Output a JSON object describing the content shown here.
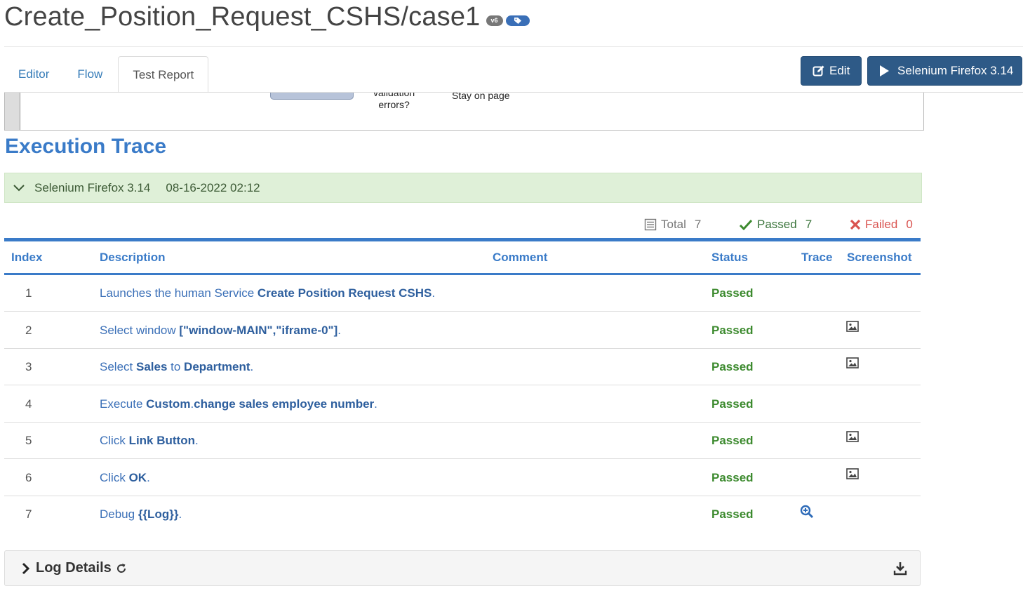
{
  "page": {
    "title": "Create_Position_Request_CSHS/case1",
    "version_badge": "v6"
  },
  "tabs": [
    {
      "label": "Editor"
    },
    {
      "label": "Flow"
    },
    {
      "label": "Test Report"
    }
  ],
  "toolbar": {
    "edit_label": "Edit",
    "run_label": "Selenium Firefox 3.14"
  },
  "diagram": {
    "question_line1": "validation",
    "question_line2": "errors?",
    "outcome": "Stay on page"
  },
  "section_title": "Execution Trace",
  "run": {
    "browser": "Selenium Firefox 3.14",
    "timestamp": "08-16-2022 02:12"
  },
  "summary": {
    "total_label": "Total",
    "total_value": "7",
    "passed_label": "Passed",
    "passed_value": "7",
    "failed_label": "Failed",
    "failed_value": "0"
  },
  "table": {
    "headers": {
      "index": "Index",
      "description": "Description",
      "comment": "Comment",
      "status": "Status",
      "trace": "Trace",
      "screenshot": "Screenshot"
    },
    "rows": [
      {
        "index": "1",
        "pre": "Launches the human Service ",
        "b1": "Create Position Request CSHS",
        "mid": "",
        "b2": "",
        "post": ".",
        "status": "Passed",
        "trace": false,
        "screenshot": false
      },
      {
        "index": "2",
        "pre": "Select window ",
        "b1": "[\"window-MAIN\",\"iframe-0\"]",
        "mid": "",
        "b2": "",
        "post": ".",
        "status": "Passed",
        "trace": false,
        "screenshot": true
      },
      {
        "index": "3",
        "pre": "Select ",
        "b1": "Sales",
        "mid": " to ",
        "b2": "Department",
        "post": ".",
        "status": "Passed",
        "trace": false,
        "screenshot": true
      },
      {
        "index": "4",
        "pre": "Execute ",
        "b1": "Custom",
        "mid": ".",
        "b2": "change sales employee number",
        "post": ".",
        "status": "Passed",
        "trace": false,
        "screenshot": false
      },
      {
        "index": "5",
        "pre": "Click ",
        "b1": "Link Button",
        "mid": "",
        "b2": "",
        "post": ".",
        "status": "Passed",
        "trace": false,
        "screenshot": true
      },
      {
        "index": "6",
        "pre": "Click ",
        "b1": "OK",
        "mid": "",
        "b2": "",
        "post": ".",
        "status": "Passed",
        "trace": false,
        "screenshot": true
      },
      {
        "index": "7",
        "pre": "Debug ",
        "b1": "{{Log}}",
        "mid": "",
        "b2": "",
        "post": ".",
        "status": "Passed",
        "trace": true,
        "screenshot": false
      }
    ]
  },
  "log_details": {
    "label": "Log Details"
  },
  "colors": {
    "accent_blue": "#3a7bc8",
    "passed_green": "#3c8a2e",
    "failed_red": "#d9534f",
    "run_bar_bg": "#dff0d8",
    "button_bg": "#2e5a87"
  },
  "icons": {
    "edit": "edit-icon",
    "run": "play-icon",
    "run_bar": "chevron-down-icon",
    "total": "list-icon",
    "passed": "check-icon",
    "failed": "x-icon",
    "trace": "zoom-in-icon",
    "screenshot": "image-icon",
    "log_toggle": "chevron-right-icon",
    "refresh": "refresh-icon",
    "download": "download-icon"
  }
}
